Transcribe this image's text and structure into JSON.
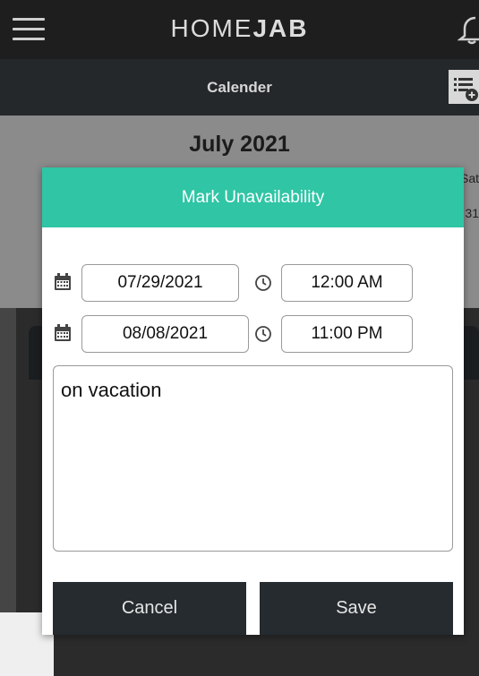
{
  "header": {
    "logo_part1": "HOME",
    "logo_part2": "JAB"
  },
  "subheader": {
    "title": "Calender"
  },
  "calendar": {
    "month": "July 2021",
    "sat_label": "Sat",
    "sat_date": "31"
  },
  "modal": {
    "title": "Mark Unavailability",
    "start_date": "07/29/2021",
    "start_time": "12:00 AM",
    "end_date": "08/08/2021",
    "end_time": "11:00 PM",
    "notes": "on vacation",
    "cancel_label": "Cancel",
    "save_label": "Save"
  },
  "colors": {
    "accent": "#2fc5a5",
    "button_bg": "#252b2f",
    "header_bg": "#1e1e1e"
  },
  "icons": [
    "menu-icon",
    "bell-icon",
    "list-add-icon",
    "calendar-icon",
    "clock-icon"
  ]
}
